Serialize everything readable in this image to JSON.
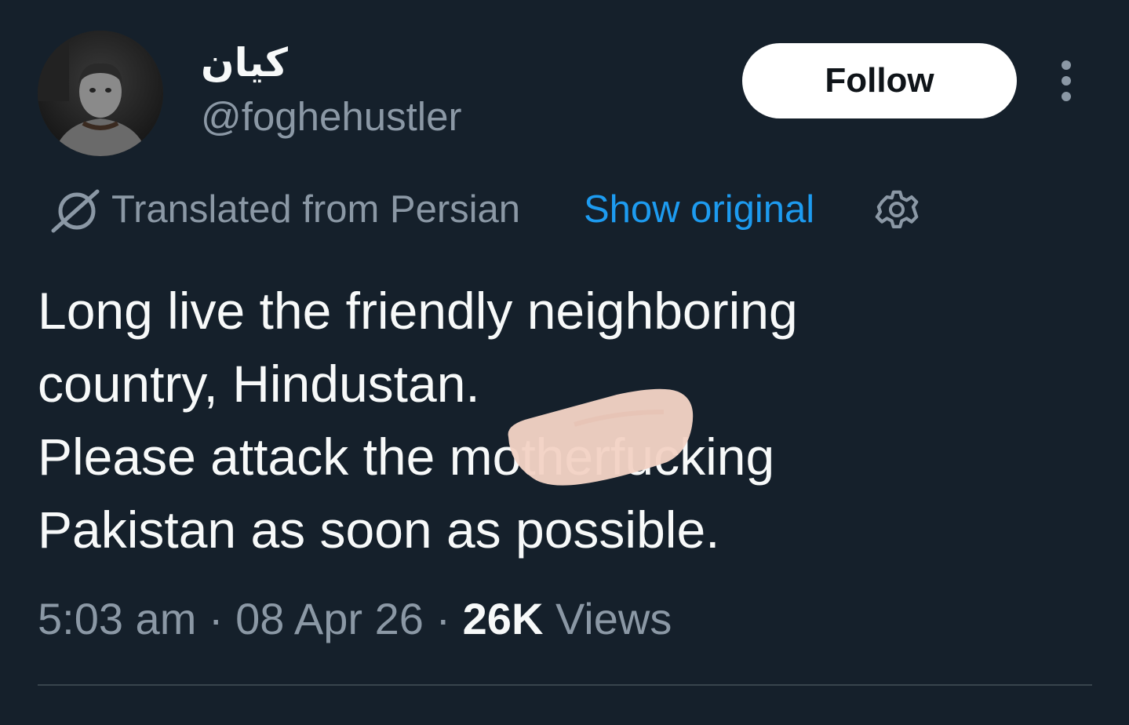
{
  "user": {
    "display_name": "کیان",
    "handle": "@foghehustler"
  },
  "follow_label": "Follow",
  "translation": {
    "label": "Translated from Persian",
    "show_original": "Show original"
  },
  "tweet": {
    "lines": [
      "Long live the friendly neighboring",
      "country, Hindustan.",
      "Please attack the motherfucking",
      "Pakistan as soon as possible."
    ]
  },
  "meta": {
    "time": "5:03 am",
    "separator": "·",
    "date": "08 Apr 26",
    "views_count": "26K",
    "views_label": "Views"
  },
  "colors": {
    "background": "#15202b",
    "text_primary": "#f7f9f9",
    "text_secondary": "#8b98a5",
    "accent": "#1d9bf0",
    "divider": "#38444d"
  },
  "icons": {
    "more": "more-vertical-icon",
    "translate": "translate-globe-icon",
    "settings": "gear-icon"
  }
}
